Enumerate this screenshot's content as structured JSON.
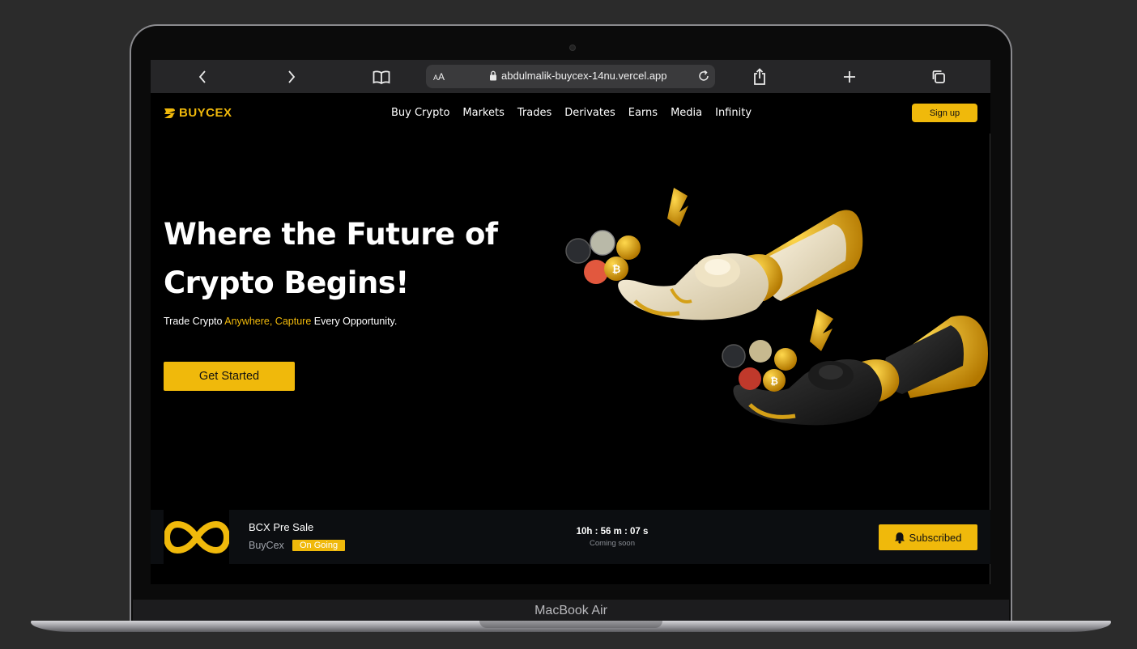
{
  "device": {
    "label": "MacBook Air"
  },
  "browser": {
    "text_size_label_small": "A",
    "text_size_label_large": "A",
    "url": "abdulmalik-buycex-14nu.vercel.app",
    "icons": [
      "chevron-left-icon",
      "chevron-right-icon",
      "book-icon",
      "lock-icon",
      "reload-icon",
      "share-icon",
      "plus-icon",
      "tabs-icon"
    ]
  },
  "site": {
    "logo_text": "BUYCEX",
    "nav": [
      "Buy Crypto",
      "Markets",
      "Trades",
      "Derivates",
      "Earns",
      "Media",
      "Infinity"
    ],
    "signup_label": "Sign up",
    "accent_color": "#f0b90b"
  },
  "hero": {
    "title": "Where the Future of Crypto Begins!",
    "subtitle_parts": [
      "Trade Crypto ",
      "Anywhere, Capture",
      " Every Opportunity."
    ],
    "cta_label": "Get Started"
  },
  "presale": {
    "name": "BCX Pre Sale",
    "brand": "BuyCex",
    "status": "On Going",
    "countdown": "10h : 56 m : 07 s",
    "countdown_label": "Coming soon",
    "button_label": "Subscribed"
  }
}
